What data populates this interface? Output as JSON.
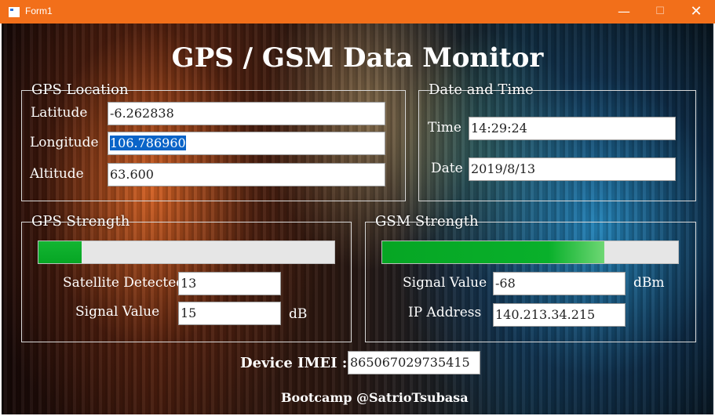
{
  "window": {
    "title": "Form1",
    "minimize_glyph": "—",
    "maximize_glyph": "☐",
    "close_glyph": "✕"
  },
  "heading": "GPS / GSM Data Monitor",
  "gps_location": {
    "legend": "GPS Location",
    "latitude_label": "Latitude",
    "latitude_value": "-6.262838",
    "longitude_label": "Longitude",
    "longitude_value": "106.786960",
    "altitude_label": "Altitude",
    "altitude_value": "63.600"
  },
  "date_time": {
    "legend": "Date and Time",
    "time_label": "Time",
    "time_value": "14:29:24",
    "date_label": "Date",
    "date_value": "2019/8/13"
  },
  "gps_strength": {
    "legend": "GPS Strength",
    "bar_level_fraction": 0.146,
    "satellite_label": "Satellite Detected",
    "satellite_value": "13",
    "signal_label": "Signal Value",
    "signal_value": "15",
    "signal_unit": "dB"
  },
  "gsm_strength": {
    "legend": "GSM Strength",
    "bar_level_fraction": 0.75,
    "signal_label": "Signal Value",
    "signal_value": "-68",
    "signal_unit": "dBm",
    "ip_label": "IP Address",
    "ip_value": "140.213.34.215"
  },
  "device": {
    "imei_label": "Device IMEI :",
    "imei_value": "865067029735415"
  },
  "credit": "Bootcamp @SatrioTsubasa",
  "colors": {
    "titlebar": "#f26f1a",
    "bar_fill": "#06a624",
    "bar_track": "#e6e6e6",
    "selection": "#0a64c8"
  }
}
